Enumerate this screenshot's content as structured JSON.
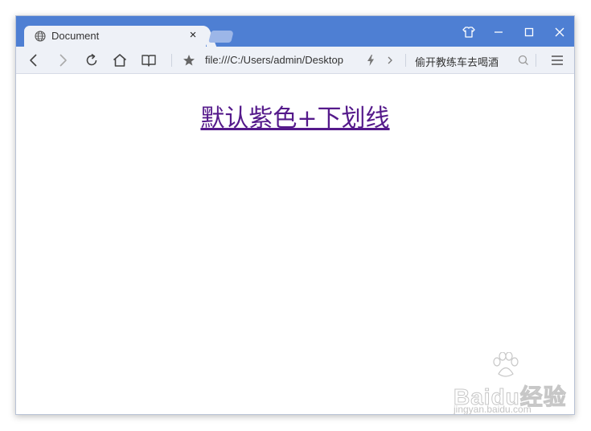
{
  "browser": {
    "tab": {
      "title": "Document",
      "close_glyph": "×",
      "icon": "globe-icon"
    },
    "window_controls": [
      "skin-icon",
      "minimize-icon",
      "maximize-icon",
      "close-icon"
    ],
    "toolbar": {
      "icons": [
        "back-icon",
        "forward-icon",
        "reload-icon",
        "home-icon",
        "reading-mode-icon",
        "bookmark-star-icon",
        "lightning-icon",
        "chevron-right-icon",
        "search-icon",
        "menu-icon"
      ],
      "url": "file:///C:/Users/admin/Desktop",
      "search_suggestion": "偷开教练车去喝酒"
    },
    "colors": {
      "titlebar": "#4e7fd3",
      "toolbar": "#eef1f7",
      "link_visited": "#551a8b"
    }
  },
  "page": {
    "link_text": "默认紫色+下划线"
  },
  "watermark": {
    "logo_text": "Baidu经验",
    "sub_text": "jingyan.baidu.com"
  }
}
